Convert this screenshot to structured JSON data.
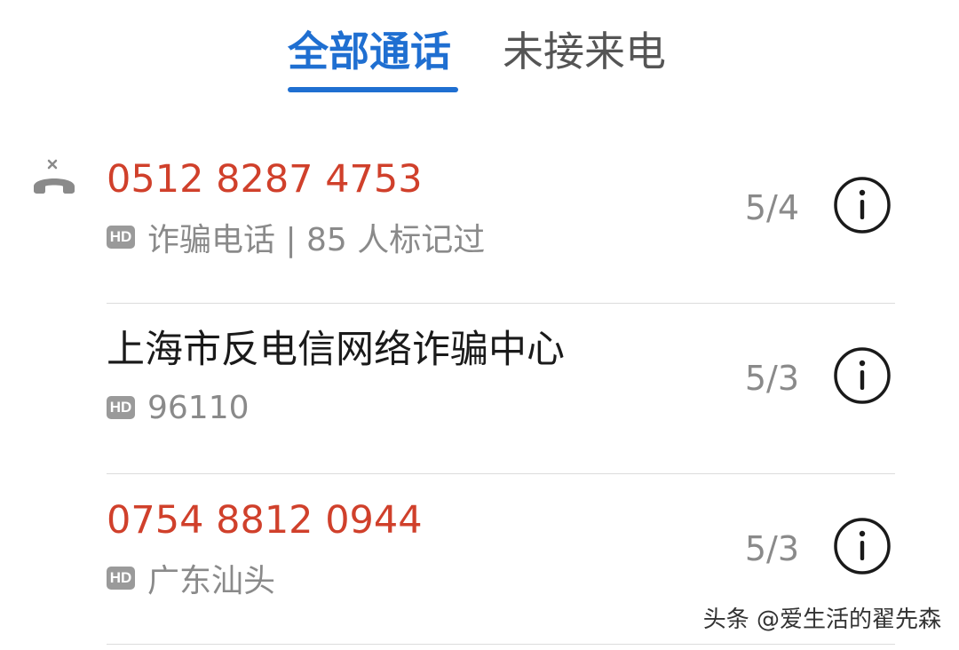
{
  "tabs": {
    "all_calls": "全部通话",
    "missed_calls": "未接来电"
  },
  "calls": [
    {
      "primary": "0512 8287 4753",
      "secondary": "诈骗电话 | 85 人标记过",
      "badge": "HD",
      "date": "5/4",
      "missed": true
    },
    {
      "primary": "上海市反电信网络诈骗中心",
      "secondary": "96110",
      "badge": "HD",
      "date": "5/3",
      "missed": false
    },
    {
      "primary": "0754 8812 0944",
      "secondary": "广东汕头",
      "badge": "HD",
      "date": "5/3",
      "missed": false
    }
  ],
  "watermark": "头条 @爱生活的翟先森",
  "colors": {
    "accent": "#1f6fd1",
    "danger": "#d0402b"
  },
  "icons": {
    "missed_call": "missed-call-icon",
    "info": "info-icon"
  }
}
